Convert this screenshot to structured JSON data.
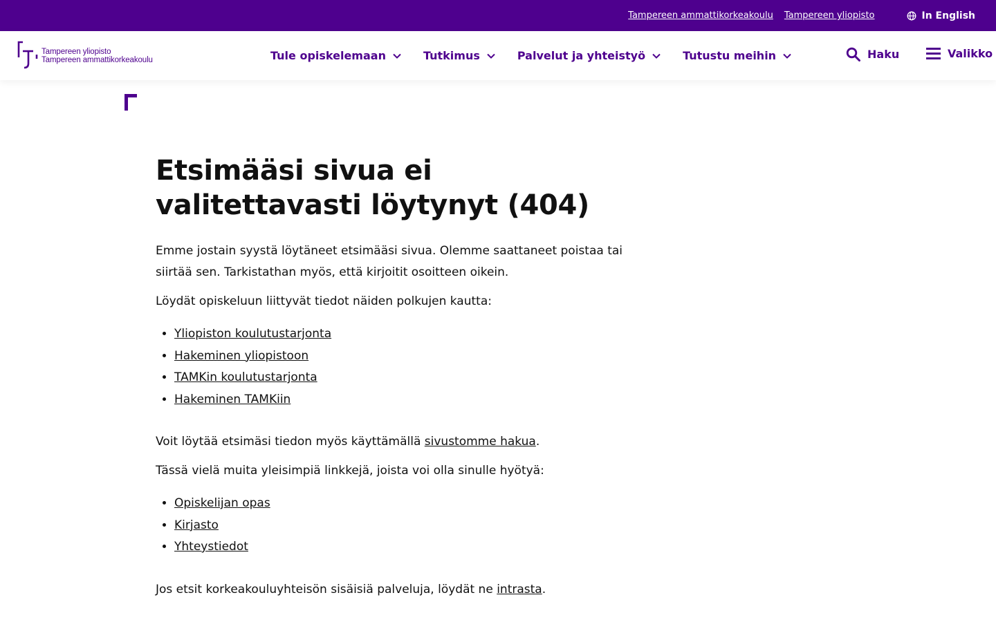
{
  "topbar": {
    "link_tamk": "Tampereen ammattikorkeakoulu",
    "link_tuni": "Tampereen yliopisto",
    "language": "In English"
  },
  "logo": {
    "line1": "Tampereen yliopisto",
    "line2": "Tampereen ammattikorkeakoulu"
  },
  "nav": {
    "items": [
      {
        "label": "Tule opiskelemaan"
      },
      {
        "label": "Tutkimus"
      },
      {
        "label": "Palvelut ja yhteistyö"
      },
      {
        "label": "Tutustu meihin"
      }
    ],
    "search_label": "Haku",
    "menu_label": "Valikko"
  },
  "main": {
    "title": "Etsimääsi sivua ei valitettavasti löytynyt (404)",
    "intro": "Emme jostain syystä löytäneet etsimääsi sivua. Olemme saattaneet poistaa tai siirtää sen. Tarkistathan myös, että kirjoitit osoitteen oikein.",
    "paths_intro": "Löydät opiskeluun liittyvät tiedot näiden polkujen kautta:",
    "paths": [
      "Yliopiston koulutustarjonta",
      "Hakeminen yliopistoon",
      "TAMKin koulutustarjonta",
      "Hakeminen TAMKiin"
    ],
    "search_text_before": "Voit löytää etsimäsi tiedon myös käyttämällä ",
    "search_link": "sivustomme hakua",
    "search_text_after": ".",
    "other_intro": "Tässä vielä muita yleisimpiä linkkejä, joista voi olla sinulle hyötyä:",
    "other_links": [
      "Opiskelijan opas",
      "Kirjasto",
      "Yhteystiedot"
    ],
    "intra_text_before": "Jos etsit korkeakouluyhteisön sisäisiä palveluja, löydät ne ",
    "intra_link": "intrasta",
    "intra_text_after": "."
  },
  "colors": {
    "brand": "#4e008e"
  }
}
